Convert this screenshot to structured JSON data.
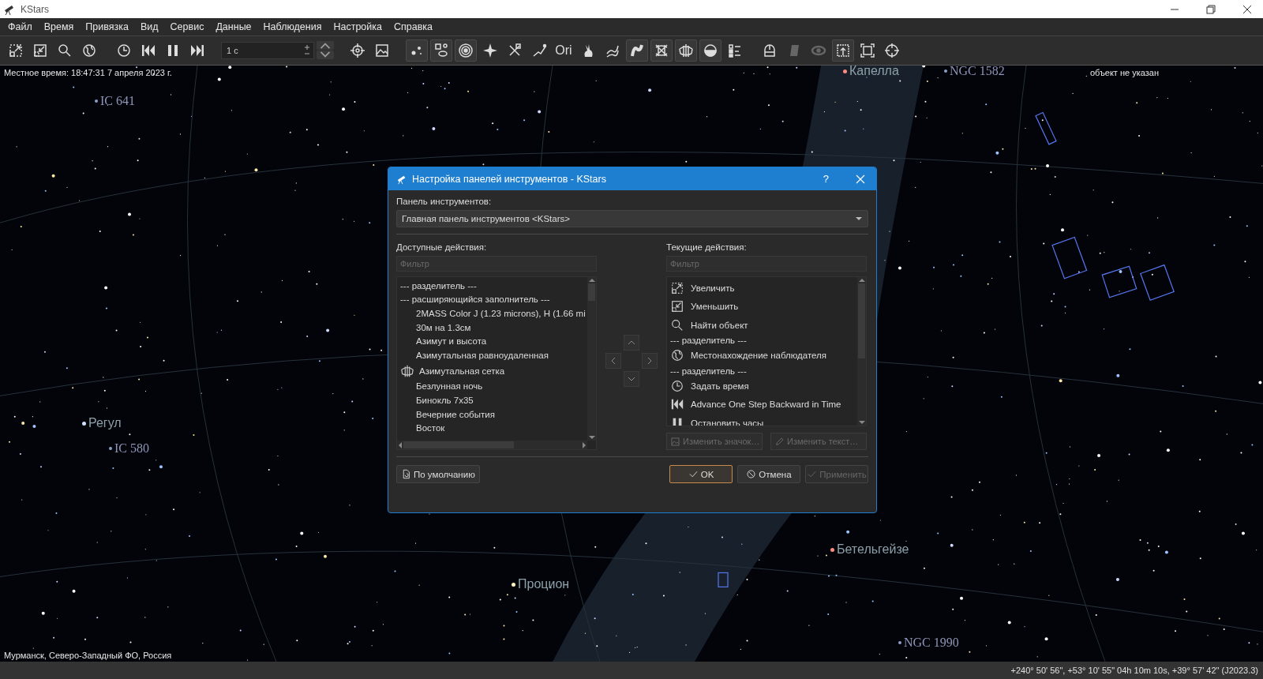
{
  "window": {
    "title": "KStars"
  },
  "menu": [
    "Файл",
    "Время",
    "Привязка",
    "Вид",
    "Сервис",
    "Данные",
    "Наблюдения",
    "Настройка",
    "Справка"
  ],
  "toolbar": {
    "time_step": {
      "value": "1 с"
    },
    "groups": [
      [
        {
          "kind": "zoom-in",
          "on": false,
          "disabled": false
        },
        {
          "kind": "zoom-out",
          "on": false,
          "disabled": false
        },
        {
          "kind": "search",
          "on": false,
          "disabled": false
        },
        {
          "kind": "globe",
          "on": false,
          "disabled": false
        }
      ],
      [
        {
          "kind": "clock",
          "on": false,
          "disabled": false
        },
        {
          "kind": "step-back",
          "on": false,
          "disabled": false
        },
        {
          "kind": "pause",
          "on": false,
          "disabled": false
        },
        {
          "kind": "step-forward",
          "on": false,
          "disabled": false
        }
      ],
      [
        {
          "kind": "target",
          "on": false,
          "disabled": false
        },
        {
          "kind": "image",
          "on": false,
          "disabled": false
        }
      ],
      [
        {
          "kind": "stars",
          "on": true,
          "disabled": false
        },
        {
          "kind": "constellation",
          "on": true,
          "disabled": false
        },
        {
          "kind": "rings",
          "on": true,
          "disabled": false
        },
        {
          "kind": "star",
          "on": false,
          "disabled": false
        },
        {
          "kind": "satellite",
          "on": false,
          "disabled": false
        },
        {
          "kind": "comet",
          "on": false,
          "disabled": false
        },
        {
          "kind": "text",
          "label": "Ori",
          "on": false,
          "disabled": false
        },
        {
          "kind": "rabbit",
          "on": false,
          "disabled": false
        },
        {
          "kind": "milky",
          "on": false,
          "disabled": false
        },
        {
          "kind": "curve",
          "on": true,
          "disabled": false
        },
        {
          "kind": "grid-crossed",
          "on": true,
          "disabled": false
        },
        {
          "kind": "grid",
          "on": true,
          "disabled": false
        },
        {
          "kind": "horizon",
          "on": true,
          "disabled": false
        },
        {
          "kind": "list",
          "on": false,
          "disabled": false
        }
      ],
      [
        {
          "kind": "dome",
          "on": false,
          "disabled": false
        },
        {
          "kind": "telescope",
          "on": false,
          "disabled": true
        },
        {
          "kind": "galaxy",
          "on": false,
          "disabled": true
        },
        {
          "kind": "export",
          "on": true,
          "disabled": false
        },
        {
          "kind": "frame",
          "on": false,
          "disabled": false
        },
        {
          "kind": "crosshair",
          "on": false,
          "disabled": false
        }
      ]
    ]
  },
  "sky": {
    "local_time": "Местное время: 18:47:31   7 апреля 2023 г.",
    "focus": "объект не указан",
    "location": "Мурманск, Северо-Западный ФО, Россия",
    "labels": [
      {
        "text": "IC 641",
        "kind": "deep-sky",
        "color": "#8aa0c8"
      },
      {
        "text": "Капелла",
        "kind": "star",
        "color": "#ff8a80"
      },
      {
        "text": "NGC 1582",
        "kind": "deep-sky",
        "color": "#8aa0c8"
      },
      {
        "text": "Регул",
        "kind": "star",
        "color": "#cfe0ff"
      },
      {
        "text": "IC 580",
        "kind": "deep-sky",
        "color": "#8aa0c8"
      },
      {
        "text": "Процион",
        "kind": "star",
        "color": "#fff3c0"
      },
      {
        "text": "Бетельгейзе",
        "kind": "star",
        "color": "#ff8a80"
      },
      {
        "text": "NGC 1990",
        "kind": "deep-sky",
        "color": "#8aa0c8"
      }
    ]
  },
  "dialog": {
    "title": "Настройка панелей инструментов - KStars",
    "help": "?",
    "toolbar_label": "Панель инструментов:",
    "toolbar_value": "Главная панель инструментов <KStars>",
    "available": {
      "label": "Доступные действия:",
      "placeholder": "Фильтр",
      "items": [
        {
          "kind": "separator",
          "label": "--- разделитель ---"
        },
        {
          "kind": "separator",
          "label": "--- расширяющийся заполнитель ---"
        },
        {
          "kind": "plain",
          "label": "2MASS Color J (1.23 microns), H (1.66 mi"
        },
        {
          "kind": "plain",
          "label": "30м на 1.3см"
        },
        {
          "kind": "plain",
          "label": "Азимут и высота"
        },
        {
          "kind": "plain",
          "label": "Азимутальная равноудаленная"
        },
        {
          "kind": "grid",
          "label": "Азимутальная сетка"
        },
        {
          "kind": "plain",
          "label": "Безлунная ночь"
        },
        {
          "kind": "plain",
          "label": "Бинокль 7x35"
        },
        {
          "kind": "plain",
          "label": "Вечерние события"
        },
        {
          "kind": "plain",
          "label": "Восток"
        }
      ]
    },
    "current": {
      "label": "Текущие действия:",
      "placeholder": "Фильтр",
      "items": [
        {
          "kind": "zoom-in",
          "label": "Увеличить"
        },
        {
          "kind": "zoom-out",
          "label": "Уменьшить"
        },
        {
          "kind": "search",
          "label": "Найти объект"
        },
        {
          "kind": "separator",
          "label": "--- разделитель ---"
        },
        {
          "kind": "globe",
          "label": "Местонахождение наблюдателя"
        },
        {
          "kind": "separator",
          "label": "--- разделитель ---"
        },
        {
          "kind": "clock",
          "label": "Задать время"
        },
        {
          "kind": "step-back",
          "label": "Advance One Step Backward in Time"
        },
        {
          "kind": "pause",
          "label": "Остановить часы"
        }
      ]
    },
    "edit_buttons": [
      {
        "label": "Изменить значок…",
        "disabled": true
      },
      {
        "label": "Изменить текст…",
        "disabled": true
      }
    ],
    "defaults_button": {
      "label": "По умолчанию"
    },
    "buttons": [
      {
        "label": "OK",
        "default": true,
        "disabled": false
      },
      {
        "label": "Отмена",
        "default": false,
        "disabled": false
      },
      {
        "label": "Применить",
        "default": false,
        "disabled": true
      }
    ]
  },
  "status_bar": {
    "coordinates": "+240° 50' 56\", +53° 10' 55\"  04h 10m 10s, +39° 57' 42\" (J2023.3)"
  }
}
